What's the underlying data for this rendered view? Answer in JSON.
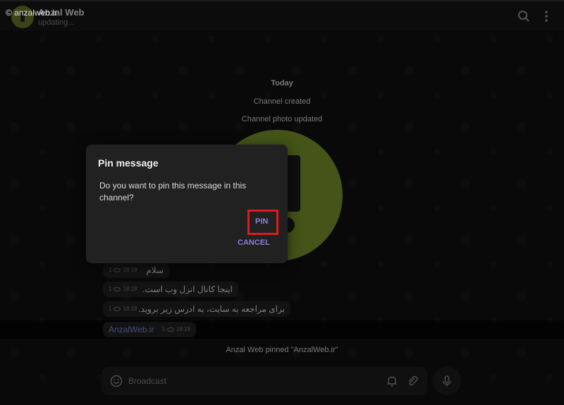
{
  "header": {
    "watermark": "© anzalweb.ir",
    "title": "Anzal Web",
    "subtitle": "updating...",
    "search_icon": "search-icon",
    "menu_icon": "kebab-menu-icon"
  },
  "service": {
    "date": "Today",
    "created": "Channel created",
    "photo_updated": "Channel photo updated",
    "pinned": "Anzal Web pinned \"AnzalWeb.ir\""
  },
  "messages": [
    {
      "text": "سلام",
      "views": "1",
      "time": "18:19"
    },
    {
      "text": "اینجا کانال انزل وب است.",
      "views": "1",
      "time": "18:19"
    },
    {
      "text": "برای مراجعه به سایت، به ادرس زیر بروید.",
      "views": "1",
      "time": "18:19"
    },
    {
      "text": "AnzalWeb.ir",
      "views": "1",
      "time": "18:19"
    }
  ],
  "composer": {
    "placeholder": "Broadcast",
    "emoji_icon": "emoji-icon",
    "bell_icon": "bell-icon",
    "attach_icon": "paperclip-icon",
    "mic_icon": "microphone-icon"
  },
  "dialog": {
    "title": "Pin message",
    "text": "Do you want to pin this message in this channel?",
    "pin_label": "PIN",
    "cancel_label": "CANCEL"
  },
  "colors": {
    "accent": "#8a7fd9",
    "highlight": "#e01a1a",
    "link": "#7d8fe0"
  }
}
